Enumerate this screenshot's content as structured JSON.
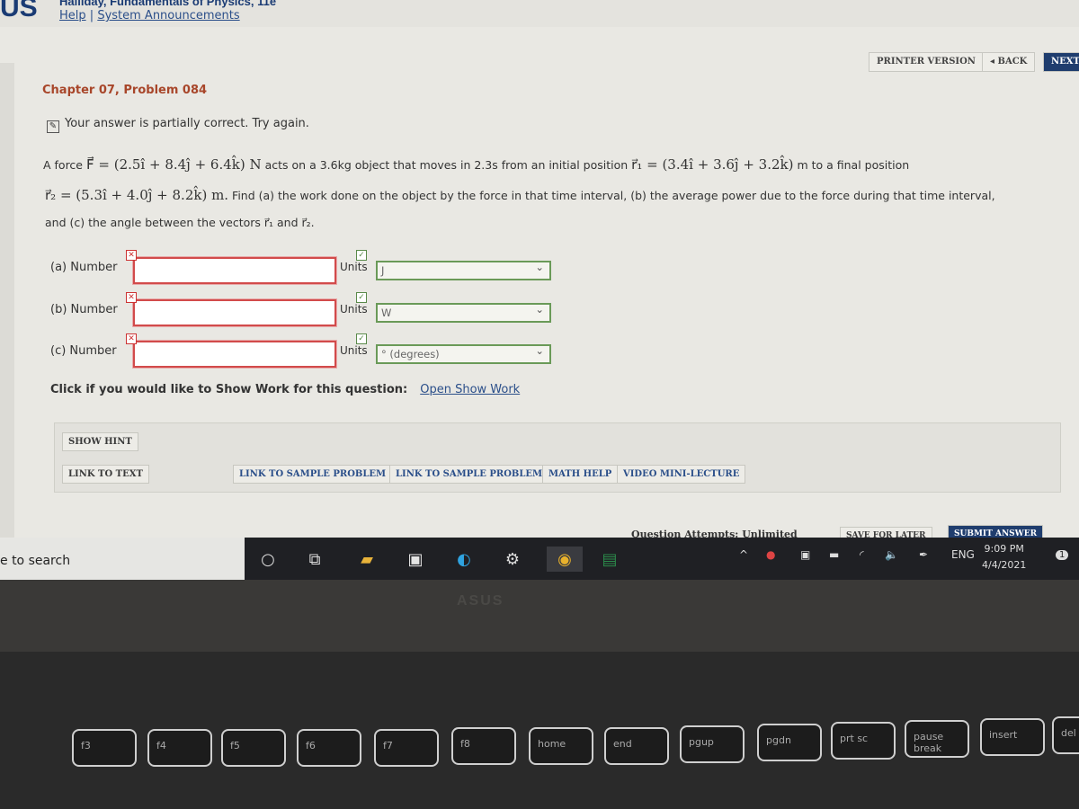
{
  "header": {
    "logo": "US",
    "book": "Halliday, Fundamentals of Physics, 11e",
    "help": "Help",
    "separator": "|",
    "announcements": "System Announcements"
  },
  "nav": {
    "printer": "PRINTER VERSION",
    "back": "◂ BACK",
    "next": "NEXT"
  },
  "problem": {
    "title": "Chapter 07, Problem 084",
    "status": "Your answer is partially correct.  Try again.",
    "line1_a": "A force ",
    "line1_F": "F⃗ = (2.5î + 8.4ĵ + 6.4k̂) N",
    "line1_b": " acts on a 3.6kg object that moves in 2.3s from an initial position ",
    "line1_r1": "r⃗₁ = (3.4î + 3.6ĵ + 3.2k̂)",
    "line1_c": " m to a final position",
    "line2_r2": "r⃗₂ = (5.3î + 4.0ĵ + 8.2k̂) m.",
    "line2_b": " Find (a) the work done on the object by the force in that time interval, (b) the average power due to the force during that time interval,",
    "line3": "and (c) the angle between the vectors r⃗₁ and r⃗₂."
  },
  "answers": [
    {
      "label": "(a) Number",
      "value": "",
      "units_label": "Units",
      "units": "J",
      "number_status": "incorrect",
      "units_status": "correct"
    },
    {
      "label": "(b) Number",
      "value": "",
      "units_label": "Units",
      "units": "W",
      "number_status": "incorrect",
      "units_status": "correct"
    },
    {
      "label": "(c) Number",
      "value": "",
      "units_label": "Units",
      "units": "° (degrees)",
      "number_status": "incorrect",
      "units_status": "correct"
    }
  ],
  "show_work": {
    "prompt": "Click if you would like to Show Work for this question:",
    "link": "Open Show Work"
  },
  "resources": {
    "hint": "SHOW HINT",
    "link_text": "LINK TO TEXT",
    "sample1": "LINK TO SAMPLE PROBLEM",
    "sample2": "LINK TO SAMPLE PROBLEM",
    "math": "MATH HELP",
    "video": "VIDEO MINI-LECTURE"
  },
  "footer": {
    "attempts": "Question Attempts: Unlimited",
    "save": "SAVE FOR LATER",
    "submit": "SUBMIT ANSWER"
  },
  "taskbar": {
    "search": "e to search",
    "lang": "ENG",
    "time": "9:09 PM",
    "date": "4/4/2021",
    "notifications": "1"
  },
  "laptop": {
    "brand": "ASUS",
    "keys": [
      "f3",
      "f4",
      "f5",
      "f6",
      "f7",
      "f8",
      "home",
      "end",
      "pgup",
      "pgdn",
      "prt sc",
      "pause break",
      "insert",
      "del"
    ]
  }
}
